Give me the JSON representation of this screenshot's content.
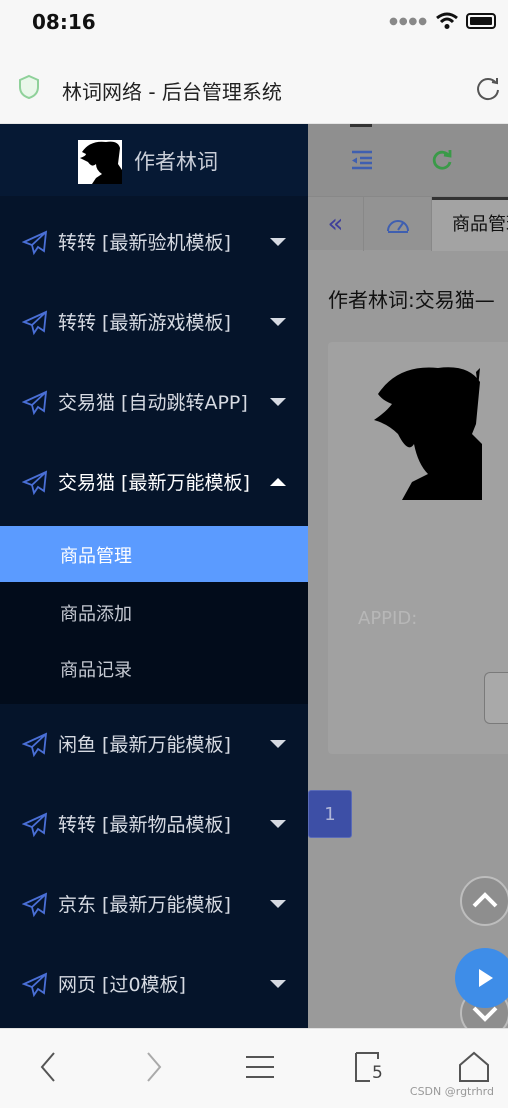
{
  "status_bar": {
    "time": "08:16"
  },
  "address_bar": {
    "title": "林词网络 - 后台管理系统"
  },
  "sidebar": {
    "author": "作者林词",
    "items": [
      {
        "label": "转转  [最新验机模板]",
        "expanded": false
      },
      {
        "label": "转转  [最新游戏模板]",
        "expanded": false
      },
      {
        "label": "交易猫  [自动跳转APP]",
        "expanded": false
      },
      {
        "label": "交易猫  [最新万能模板]",
        "expanded": true
      },
      {
        "label": "闲鱼  [最新万能模板]",
        "expanded": false
      },
      {
        "label": "转转  [最新物品模板]",
        "expanded": false
      },
      {
        "label": "京东  [最新万能模板]",
        "expanded": false
      },
      {
        "label": "网页  [过0模板]",
        "expanded": false
      }
    ],
    "submenu": [
      {
        "label": "商品管理",
        "active": true
      },
      {
        "label": "商品添加",
        "active": false
      },
      {
        "label": "商品记录",
        "active": false
      }
    ]
  },
  "content": {
    "tab_prev": "«",
    "active_tab": "商品管理",
    "heading": "作者林词:交易猫—",
    "appid_label": "APPID:",
    "page_number": "1"
  },
  "bottom_bar": {
    "tab_count": "5",
    "watermark": "CSDN @rgtrhrd"
  },
  "colors": {
    "sidebar_bg": "#05142a",
    "active_item": "#5b9bff",
    "accent_blue": "#3e8de8"
  }
}
